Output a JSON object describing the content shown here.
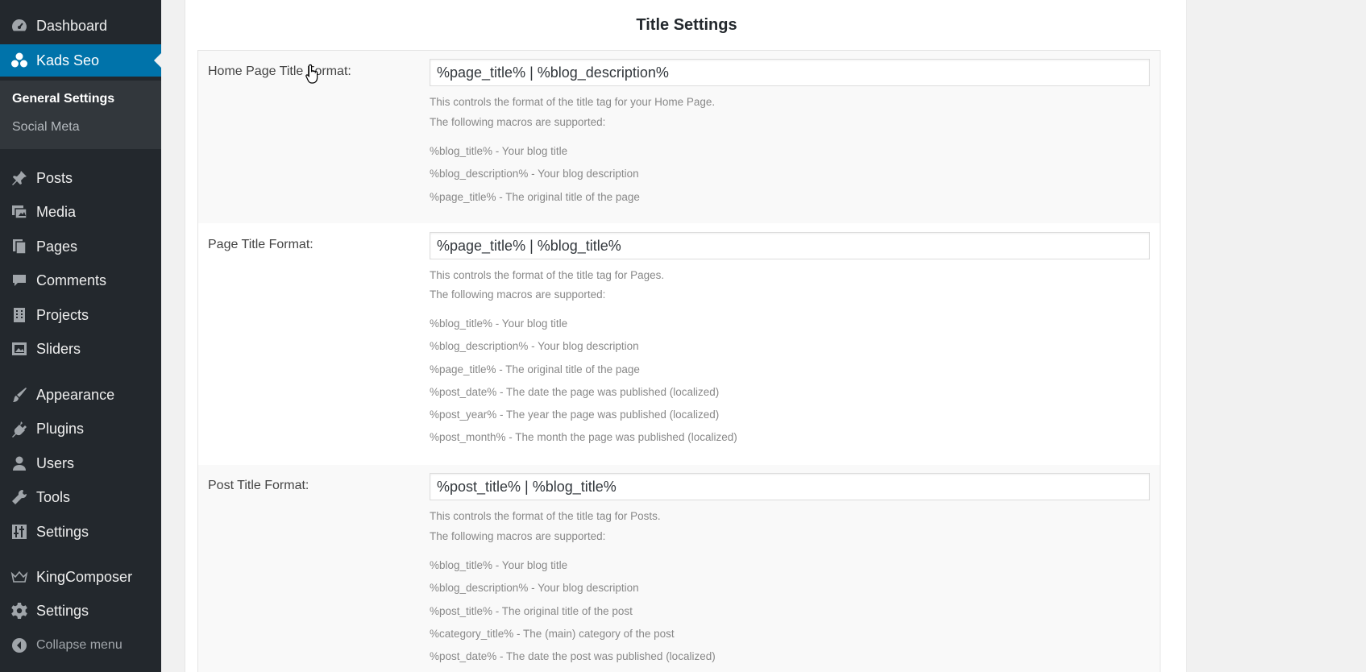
{
  "sidebar": {
    "menu": [
      {
        "label": "Dashboard",
        "icon": "dashboard-icon"
      },
      {
        "label": "Kads Seo",
        "icon": "kads-seo-icon"
      },
      {
        "label": "Posts",
        "icon": "pushpin-icon"
      },
      {
        "label": "Media",
        "icon": "media-icon"
      },
      {
        "label": "Pages",
        "icon": "pages-icon"
      },
      {
        "label": "Comments",
        "icon": "comment-icon"
      },
      {
        "label": "Projects",
        "icon": "building-icon"
      },
      {
        "label": "Sliders",
        "icon": "slides-icon"
      },
      {
        "label": "Appearance",
        "icon": "brush-icon"
      },
      {
        "label": "Plugins",
        "icon": "plug-icon"
      },
      {
        "label": "Users",
        "icon": "user-icon"
      },
      {
        "label": "Tools",
        "icon": "wrench-icon"
      },
      {
        "label": "Settings",
        "icon": "sliders-icon"
      },
      {
        "label": "KingComposer",
        "icon": "crown-icon"
      },
      {
        "label": "Settings",
        "icon": "gear-icon"
      },
      {
        "label": "Collapse menu",
        "icon": "collapse-icon"
      }
    ],
    "submenu": [
      "General Settings",
      "Social Meta"
    ]
  },
  "panel": {
    "title": "Title Settings",
    "rows": [
      {
        "label": "Home Page Title Format:",
        "value": "%page_title% | %blog_description%",
        "desc": "This controls the format of the title tag for your Home Page.",
        "macros_intro": "The following macros are supported:",
        "macros": [
          "%blog_title% - Your blog title",
          "%blog_description% - Your blog description",
          "%page_title% - The original title of the page"
        ]
      },
      {
        "label": "Page Title Format:",
        "value": "%page_title% | %blog_title%",
        "desc": "This controls the format of the title tag for Pages.",
        "macros_intro": "The following macros are supported:",
        "macros": [
          "%blog_title% - Your blog title",
          "%blog_description% - Your blog description",
          "%page_title% - The original title of the page",
          "%post_date% - The date the page was published (localized)",
          "%post_year% - The year the page was published (localized)",
          "%post_month% - The month the page was published (localized)"
        ]
      },
      {
        "label": "Post Title Format:",
        "value": "%post_title% | %blog_title%",
        "desc": "This controls the format of the title tag for Posts.",
        "macros_intro": "The following macros are supported:",
        "macros": [
          "%blog_title% - Your blog title",
          "%blog_description% - Your blog description",
          "%post_title% - The original title of the post",
          "%category_title% - The (main) category of the post",
          "%post_date% - The date the post was published (localized)"
        ]
      }
    ]
  },
  "colors": {
    "sidebar_bg": "#23282d",
    "active": "#0073aa",
    "submenu_bg": "#32373c"
  }
}
